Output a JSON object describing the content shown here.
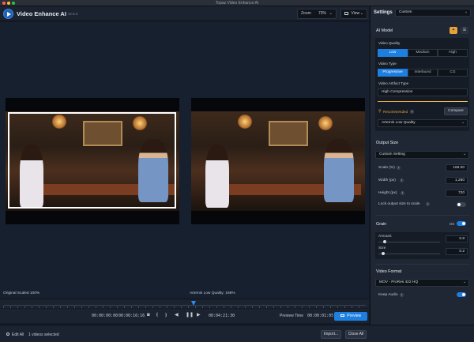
{
  "window": {
    "title": "Topaz Video Enhance AI"
  },
  "app": {
    "name": "Video Enhance AI",
    "version": "v2.6.4"
  },
  "header": {
    "zoom_label": "Zoom",
    "zoom_value": "73%",
    "view_label": "View"
  },
  "panel": {
    "settings_label": "Settings",
    "preset_value": "Custom",
    "ai_model": {
      "title": "AI Model",
      "quality_label": "Video Quality",
      "quality_options": [
        "Low",
        "Medium",
        "High"
      ],
      "quality_selected": "Low",
      "type_label": "Video Type",
      "type_options": [
        "Progressive",
        "Interlaced",
        "CG"
      ],
      "type_selected": "Progressive",
      "artifact_label": "Video Artifact Type",
      "artifact_value": "High Compression",
      "recommended_label": "Recommended",
      "compare_label": "Compare",
      "model_value": "Artemis Low Quality"
    },
    "output": {
      "title": "Output Size",
      "setting_value": "Custom Setting",
      "scale_label": "Scale (%)",
      "scale_value": "169.00",
      "width_label": "Width (px)",
      "width_value": "1,280",
      "height_label": "Height (px)",
      "height_value": "720",
      "lock_label": "Lock output size to scale"
    },
    "grain": {
      "title": "Grain",
      "state_label": "On",
      "amount_label": "Amount",
      "amount_value": "0.8",
      "size_label": "Size",
      "size_value": "0.2"
    },
    "format": {
      "title": "Video Format",
      "format_value": "MOV - ProRes 422 HQ",
      "keep_audio_label": "Keep Audio"
    }
  },
  "preview": {
    "left_label": "Original Scaled 100%",
    "right_label": "Artemis Low Quality: 169%"
  },
  "transport": {
    "start_time": "00:00:00:00",
    "end_time": "00:00:16:16",
    "current_time": "00:04:21:30",
    "preview_time_label": "Preview Time",
    "preview_time_value": "00:00:01:05",
    "preview_button": "Preview"
  },
  "footer": {
    "edit_all": "Edit All",
    "selected": "1 videos selected",
    "import": "Import...",
    "close_all": "Close All"
  },
  "colors": {
    "accent": "#1d7fe0",
    "panel": "#1e2733",
    "canvas": "#16202e"
  }
}
